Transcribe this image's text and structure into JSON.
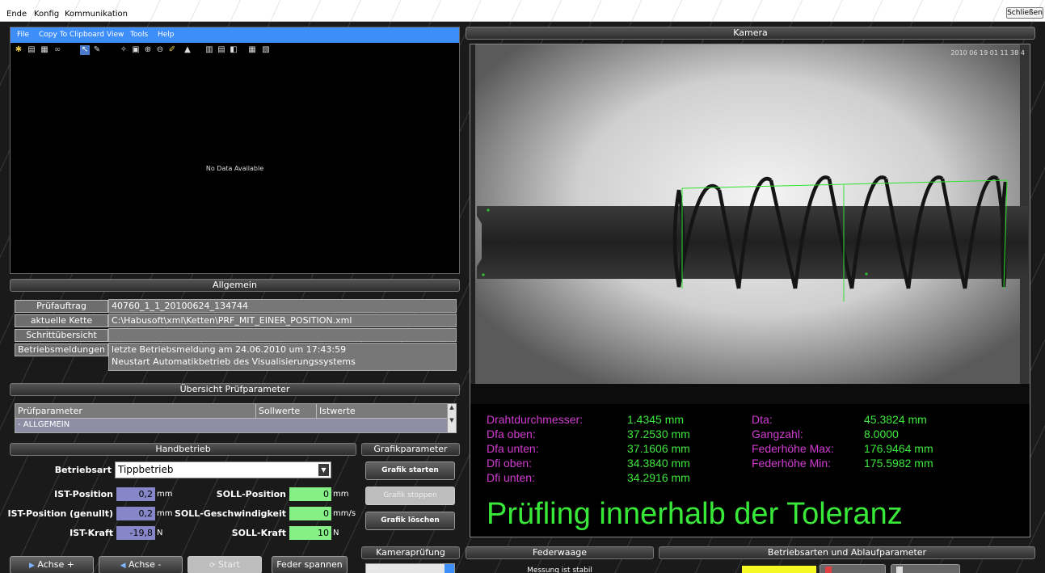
{
  "menu": {
    "items": [
      "Ende",
      "Konfig",
      "Kommunikation"
    ],
    "close": "Schließen"
  },
  "chart": {
    "menu": [
      "File",
      "Copy To Clipboard",
      "View",
      "Tools",
      "Help"
    ],
    "no_data": "No Data Available"
  },
  "allgemein": {
    "title": "Allgemein",
    "rows": [
      {
        "label": "Prüfauftrag",
        "value": "40760_1_1_20100624_134744"
      },
      {
        "label": "aktuelle Kette",
        "value": "C:\\Habusoft\\xml\\Ketten\\PRF_MIT_EINER_POSITION.xml"
      },
      {
        "label": "Schrittübersicht",
        "value": ""
      },
      {
        "label": "Betriebsmeldungen",
        "value": "letzte Betriebsmeldung am 24.06.2010 um 17:43:59",
        "value2": "Neustart Automatikbetrieb des Visualisierungssystems"
      }
    ]
  },
  "uebersicht": {
    "title": "Übersicht Prüfparameter",
    "cols": [
      "Prüfparameter",
      "Sollwerte",
      "Istwerte"
    ],
    "row": "- ALLGEMEIN"
  },
  "handbetrieb": {
    "title": "Handbetrieb",
    "betriebsart_label": "Betriebsart",
    "betriebsart_value": "Tippbetrieb",
    "ist_position_label": "IST-Position",
    "ist_position": "0,2",
    "ist_position_genullt_label": "IST-Position (genullt)",
    "ist_position_genullt": "0,2",
    "ist_kraft_label": "IST-Kraft",
    "ist_kraft": "-19,8",
    "soll_position_label": "SOLL-Position",
    "soll_position": "0",
    "soll_geschw_label": "SOLL-Geschwindigkeit",
    "soll_geschw": "0",
    "soll_kraft_label": "SOLL-Kraft",
    "soll_kraft": "10",
    "unit_mm": "mm",
    "unit_mms": "mm/s",
    "unit_n": "N",
    "btn_achse_plus": "Achse +",
    "btn_achse_minus": "Achse -",
    "btn_start": "Start",
    "btn_feder": "Feder spannen"
  },
  "grafik": {
    "title": "Grafikparameter",
    "start": "Grafik starten",
    "stop": "Grafik stoppen",
    "clear": "Grafik löschen"
  },
  "kamera": {
    "title": "Kamera",
    "timestamp": "2010 06 19 01 11 38 4",
    "measurements_left": [
      {
        "label": "Drahtdurchmesser:",
        "value": "1.4345 mm"
      },
      {
        "label": "Dfa oben:",
        "value": "37.2530 mm"
      },
      {
        "label": "Dfa unten:",
        "value": "37.1606 mm"
      },
      {
        "label": "Dfi oben:",
        "value": "34.3840 mm"
      },
      {
        "label": "Dfi unten:",
        "value": "34.2916 mm"
      }
    ],
    "measurements_right": [
      {
        "label": "Dta:",
        "value": "45.3824 mm"
      },
      {
        "label": "Gangzahl:",
        "value": "8.0000"
      },
      {
        "label": "Federhöhe Max:",
        "value": "176.9464 mm"
      },
      {
        "label": "Federhöhe Min:",
        "value": "175.5982 mm"
      }
    ],
    "status": "Prüfling innerhalb der Toleranz"
  },
  "bottom": {
    "kamerapruefung": "Kameraprüfung",
    "federwaage": "Federwaage",
    "federwaage_status": "Messung ist stabil",
    "betriebsarten": "Betriebsarten und Ablaufparameter"
  },
  "colors": {
    "accent": "#3d8ef8",
    "measure_label": "#d23cd2",
    "measure_value": "#3de83d",
    "field_purple": "#8686c8",
    "field_green": "#86f086"
  }
}
